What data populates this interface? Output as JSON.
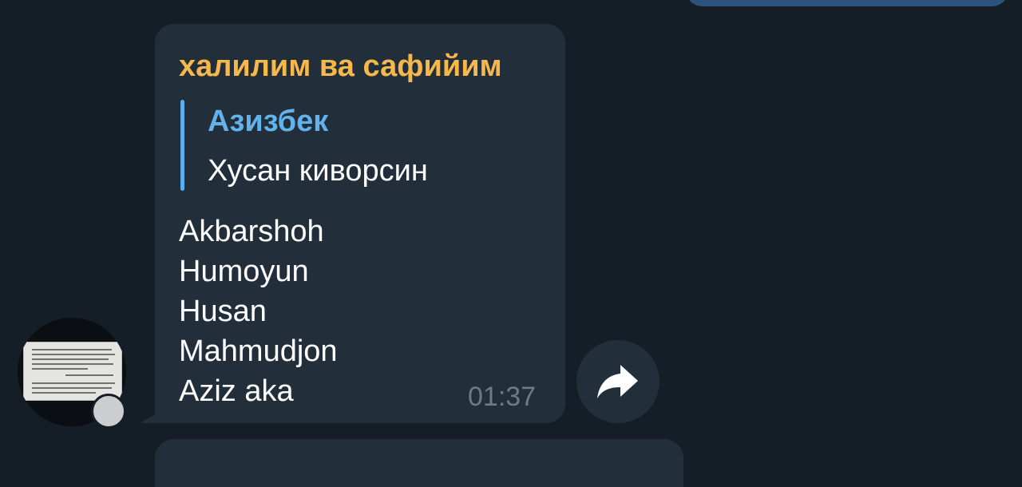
{
  "message": {
    "sender": "халилим ва сафийим",
    "reply": {
      "author": "Азизбек",
      "text": "Хусан киворсин"
    },
    "lines": [
      "Akbarshoh",
      "Humoyun",
      "Husan",
      "Mahmudjon",
      "Aziz aka"
    ],
    "time": "01:37"
  },
  "icons": {
    "forward": "forward-arrow-icon",
    "avatar": "user-avatar-photo"
  },
  "colors": {
    "background": "#151e27",
    "bubble": "#222e3a",
    "outgoing_bubble": "#2b5278",
    "sender_name": "#f7b84b",
    "reply_accent": "#62b2ec",
    "text": "#ffffff",
    "time": "#6c7b89"
  }
}
